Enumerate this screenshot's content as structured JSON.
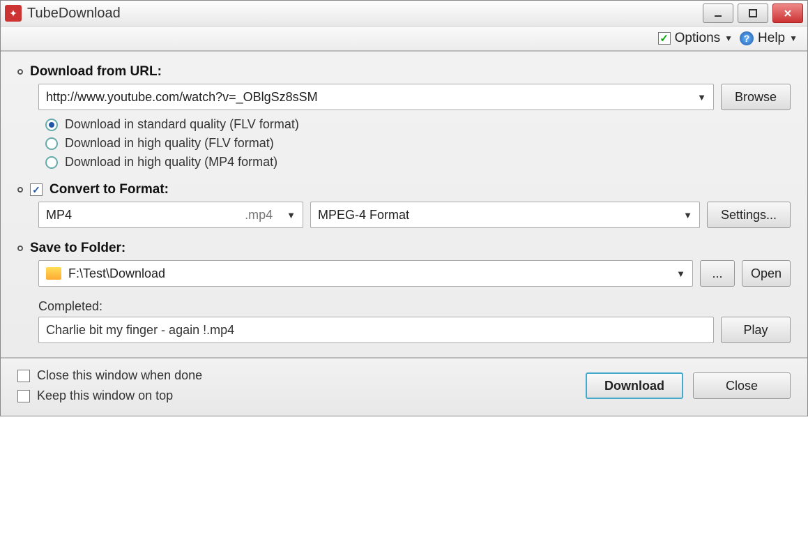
{
  "titlebar": {
    "title": "TubeDownload"
  },
  "menubar": {
    "options_label": "Options",
    "help_label": "Help"
  },
  "url_section": {
    "label": "Download from URL:",
    "value": "http://www.youtube.com/watch?v=_OBlgSz8sSM",
    "browse_label": "Browse"
  },
  "quality_options": [
    {
      "label": "Download in standard quality (FLV format)",
      "selected": true
    },
    {
      "label": "Download in high quality (FLV format)",
      "selected": false
    },
    {
      "label": "Download in high quality (MP4 format)",
      "selected": false
    }
  ],
  "convert_section": {
    "checked": true,
    "label": "Convert to Format:",
    "format": "MP4",
    "ext": ".mp4",
    "codec": "MPEG-4 Format",
    "settings_label": "Settings..."
  },
  "save_section": {
    "label": "Save to Folder:",
    "path": "F:\\Test\\Download",
    "browse_label": "...",
    "open_label": "Open"
  },
  "completed": {
    "label": "Completed:",
    "file": "Charlie bit my finger - again !.mp4",
    "play_label": "Play"
  },
  "footer": {
    "close_when_done": "Close this window when done",
    "keep_on_top": "Keep this window on top",
    "download_label": "Download",
    "close_label": "Close"
  }
}
